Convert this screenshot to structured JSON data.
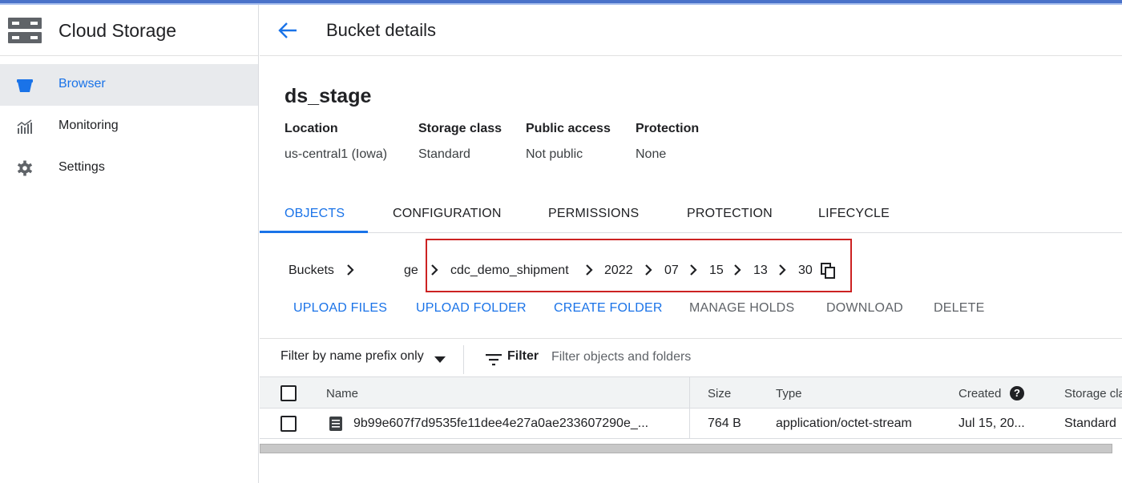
{
  "sidebar": {
    "app_title": "Cloud Storage",
    "items": [
      {
        "label": "Browser",
        "icon": "bucket-icon",
        "active": true
      },
      {
        "label": "Monitoring",
        "icon": "monitoring-chart-icon",
        "active": false
      },
      {
        "label": "Settings",
        "icon": "gear-icon",
        "active": false
      }
    ]
  },
  "header": {
    "title": "Bucket details",
    "back_icon": "arrow-back-icon"
  },
  "bucket": {
    "name": "ds_stage",
    "properties": [
      {
        "label": "Location",
        "value": "us-central1 (Iowa)"
      },
      {
        "label": "Storage class",
        "value": "Standard"
      },
      {
        "label": "Public access",
        "value": "Not public"
      },
      {
        "label": "Protection",
        "value": "None"
      }
    ]
  },
  "tabs": [
    "OBJECTS",
    "CONFIGURATION",
    "PERMISSIONS",
    "PROTECTION",
    "LIFECYCLE"
  ],
  "breadcrumb": [
    "Buckets",
    "ge",
    "cdc_demo_shipment",
    "2022",
    "07",
    "15",
    "13",
    "30"
  ],
  "actions": [
    {
      "label": "UPLOAD FILES",
      "enabled": true
    },
    {
      "label": "UPLOAD FOLDER",
      "enabled": true
    },
    {
      "label": "CREATE FOLDER",
      "enabled": true
    },
    {
      "label": "MANAGE HOLDS",
      "enabled": false
    },
    {
      "label": "DOWNLOAD",
      "enabled": false
    },
    {
      "label": "DELETE",
      "enabled": false
    }
  ],
  "filter": {
    "mode": "Filter by name prefix only",
    "label": "Filter",
    "placeholder": "Filter objects and folders"
  },
  "table": {
    "columns": [
      "Name",
      "Size",
      "Type",
      "Created",
      "Storage cla"
    ],
    "rows": [
      {
        "name": "9b99e607f7d9535fe11dee4e27a0ae233607290e_...",
        "size": "764 B",
        "type": "application/octet-stream",
        "created": "Jul 15, 20...",
        "storage_class": "Standard"
      }
    ]
  },
  "colors": {
    "accent": "#1a73e8",
    "highlight": "#cc2222",
    "topbar": "#4a72c9"
  }
}
